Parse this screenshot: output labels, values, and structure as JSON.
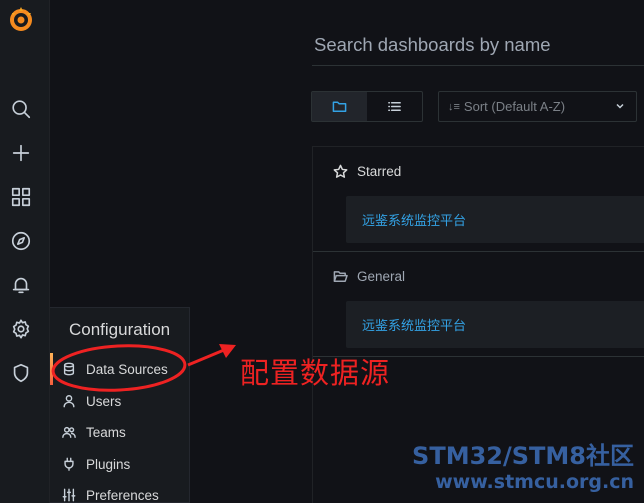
{
  "search": {
    "placeholder": "Search dashboards by name"
  },
  "sort": {
    "label": "Sort (Default A-Z)"
  },
  "sections": [
    {
      "title": "Starred",
      "dashboard": "远鉴系统监控平台"
    },
    {
      "title": "General",
      "dashboard": "远鉴系统监控平台"
    }
  ],
  "flyout": {
    "title": "Configuration",
    "items": [
      "Data Sources",
      "Users",
      "Teams",
      "Plugins",
      "Preferences"
    ]
  },
  "annotation": {
    "text": "配置数据源",
    "color": "#ee2222"
  },
  "watermark": {
    "line1": "STM32/STM8社区",
    "line2": "www.stmcu.org.cn"
  },
  "colors": {
    "link": "#33a2e5",
    "accent": "#f55f3e"
  }
}
